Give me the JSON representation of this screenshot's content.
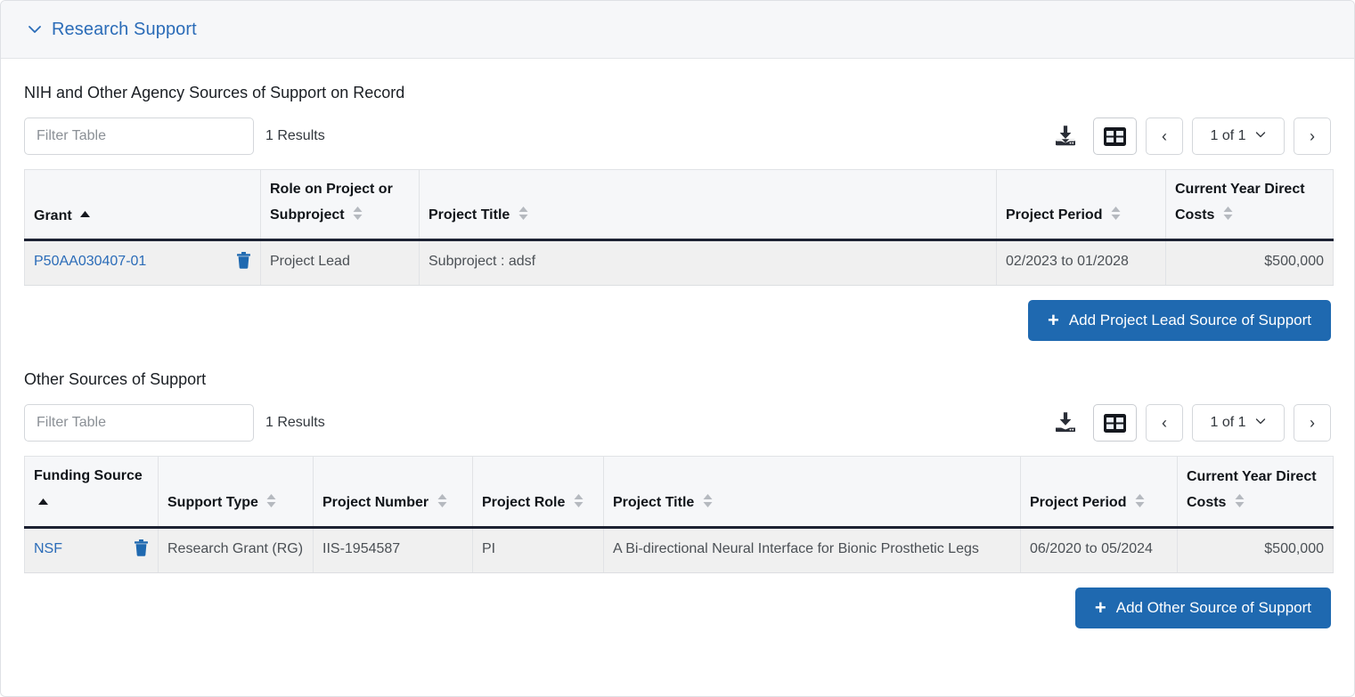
{
  "section": {
    "title": "Research Support",
    "collapse_icon": "chevron-down-icon"
  },
  "tables": [
    {
      "heading": "NIH and Other Agency Sources of Support on Record",
      "filter_placeholder": "Filter Table",
      "filter_value": "",
      "results_text": "1 Results",
      "toolbar": {
        "download_icon": "download-icon",
        "grid_icon": "table-grid-icon",
        "prev_label": "‹",
        "next_label": "›",
        "page_label": "1 of 1",
        "page_chevron": "chevron-down-icon"
      },
      "columns": [
        {
          "label": "Grant",
          "sort": "asc"
        },
        {
          "label": "Role on Project or Subproject",
          "sort": "both"
        },
        {
          "label": "Project Title",
          "sort": "both"
        },
        {
          "label": "Project Period",
          "sort": "both"
        },
        {
          "label": "Current Year Direct Costs",
          "sort": "both"
        }
      ],
      "rows": [
        {
          "grant": "P50AA030407-01",
          "delete_icon": "trash-icon",
          "role": "Project Lead",
          "title": "Subproject : adsf",
          "period": "02/2023 to 01/2028",
          "costs": "$500,000"
        }
      ],
      "add_button": {
        "label": "Add Project Lead Source of Support",
        "icon": "plus-icon"
      }
    },
    {
      "heading": "Other Sources of Support",
      "filter_placeholder": "Filter Table",
      "filter_value": "",
      "results_text": "1 Results",
      "toolbar": {
        "download_icon": "download-icon",
        "grid_icon": "table-grid-icon",
        "prev_label": "‹",
        "next_label": "›",
        "page_label": "1 of 1",
        "page_chevron": "chevron-down-icon"
      },
      "columns": [
        {
          "label": "Funding Source",
          "sort": "asc"
        },
        {
          "label": "Support Type",
          "sort": "both"
        },
        {
          "label": "Project Number",
          "sort": "both"
        },
        {
          "label": "Project Role",
          "sort": "both"
        },
        {
          "label": "Project Title",
          "sort": "both"
        },
        {
          "label": "Project Period",
          "sort": "both"
        },
        {
          "label": "Current Year Direct Costs",
          "sort": "both"
        }
      ],
      "rows": [
        {
          "source": "NSF",
          "delete_icon": "trash-icon",
          "support_type": "Research Grant (RG)",
          "project_number": "IIS-1954587",
          "project_role": "PI",
          "title": "A Bi-directional Neural Interface for Bionic Prosthetic Legs",
          "period": "06/2020 to 05/2024",
          "costs": "$500,000"
        }
      ],
      "add_button": {
        "label": "Add Other Source of Support",
        "icon": "plus-icon"
      }
    }
  ],
  "colors": {
    "link": "#2b6cb8",
    "primary_button": "#1f69b0",
    "header_band": "#f6f7f9",
    "row_bg": "#f0f0f0",
    "header_rule": "#1d2233"
  }
}
